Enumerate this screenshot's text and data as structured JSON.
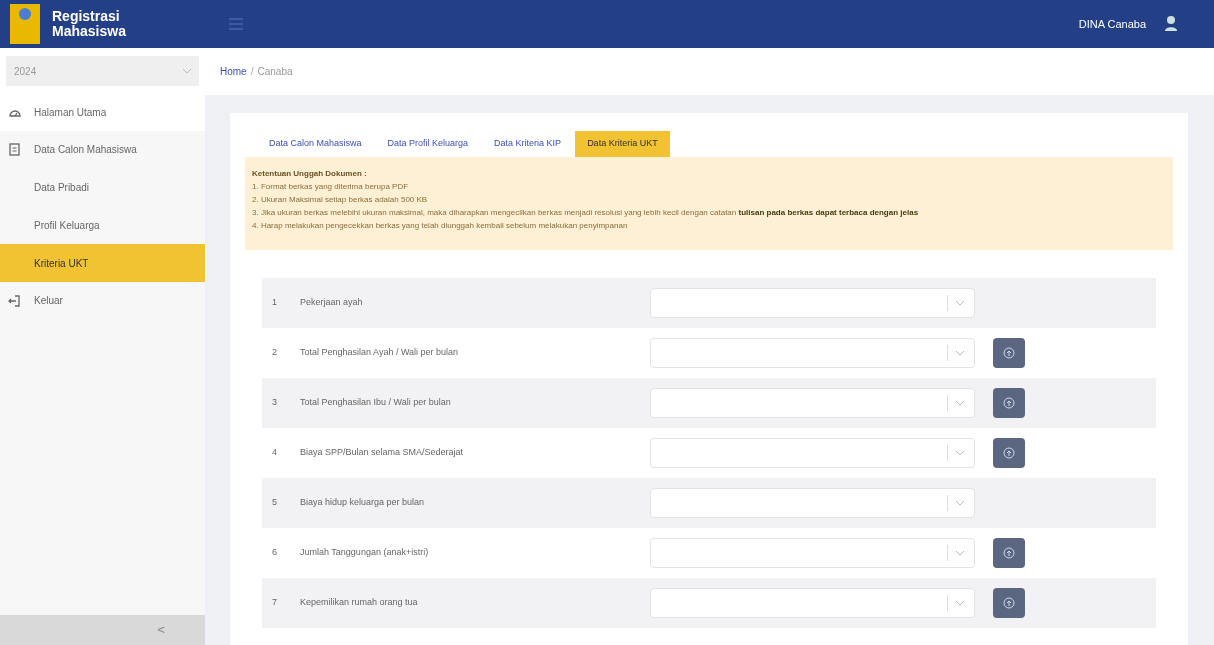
{
  "header": {
    "title": "Registrasi Mahasiswa",
    "user": "DINA Canaba"
  },
  "sidebar": {
    "year": "2024",
    "items": [
      {
        "label": "Halaman Utama",
        "selected": false
      },
      {
        "label": "Data Calon Mahasiswa",
        "selected": false,
        "children": [
          {
            "label": "Data Pribadi",
            "selected": false
          },
          {
            "label": "Profil Keluarga",
            "selected": false
          },
          {
            "label": "Kriteria UKT",
            "selected": true
          }
        ]
      },
      {
        "label": "Keluar",
        "selected": false
      }
    ],
    "collapse": "<"
  },
  "breadcrumb": {
    "home": "Home",
    "separator": "/",
    "current": "Canaba"
  },
  "tabs": [
    {
      "label": "Data Calon Mahasiswa",
      "selected": false
    },
    {
      "label": "Data Profil Keluarga",
      "selected": false
    },
    {
      "label": "Data Kriteria KIP",
      "selected": false
    },
    {
      "label": "Data Kriteria UKT",
      "selected": true
    }
  ],
  "notice": {
    "title": "Ketentuan Unggah Dokumen :",
    "lines": [
      "1. Format berkas yang diterima berupa PDF",
      "2. Ukuran Maksimal setiap berkas adalah 500 KB",
      "3. Jika ukuran berkas melebihi ukuran maksimal, maka diharapkan mengecilkan berkas menjadi resolusi yang lebih kecil dengan catatan **tulisan pada berkas dapat terbaca dengan jelas**",
      "4. Harap melakukan pengecekkan berkas yang telah diunggah kembali sebelum melakukan penyimpanan"
    ]
  },
  "rows": [
    {
      "number": "1",
      "label": "Pekerjaan ayah",
      "upload": false
    },
    {
      "number": "2",
      "label": "Total Penghasilan Ayah / Wali per bulan",
      "upload": true
    },
    {
      "number": "3",
      "label": "Total Penghasilan Ibu / Wali per bulan",
      "upload": true
    },
    {
      "number": "4",
      "label": "Biaya SPP/Bulan selama SMA/Sederajat",
      "upload": true
    },
    {
      "number": "5",
      "label": "Biaya hidup keluarga per bulan",
      "upload": false
    },
    {
      "number": "6",
      "label": "Jumlah Tanggungan (anak+istri)",
      "upload": true
    },
    {
      "number": "7",
      "label": "Kepemilikan rumah orang tua",
      "upload": true
    }
  ]
}
